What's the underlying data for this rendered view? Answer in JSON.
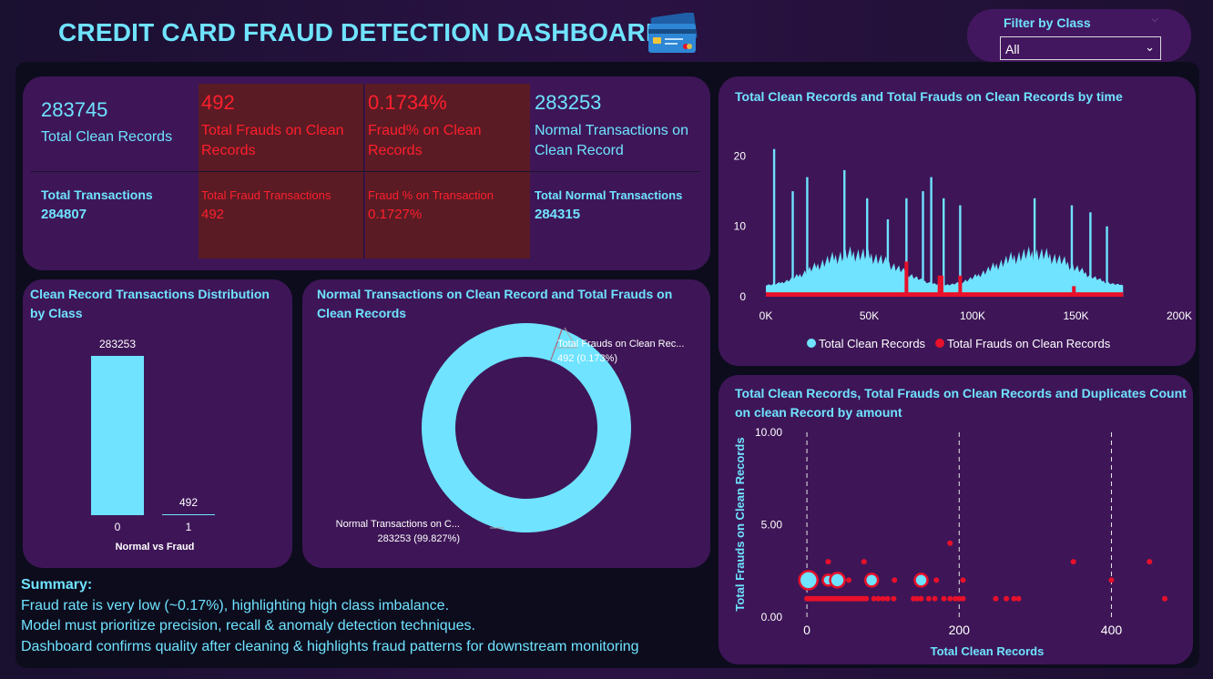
{
  "header": {
    "title": "CREDIT CARD FRAUD DETECTION DASHBOARD",
    "card_icon": "credit-card-icon"
  },
  "filter": {
    "label": "Filter by Class",
    "value": "All"
  },
  "kpis": {
    "row1": [
      {
        "value": "283745",
        "label": "Total Clean Records"
      },
      {
        "value": "492",
        "label": "Total Frauds on Clean Records"
      },
      {
        "value": "0.1734%",
        "label": "Fraud% on Clean Records"
      },
      {
        "value": "283253",
        "label": "Normal Transactions on Clean Record"
      }
    ],
    "row2": [
      {
        "label": "Total Transactions",
        "value": "284807"
      },
      {
        "label": "Total Fraud Transactions",
        "value": "492"
      },
      {
        "label": "Fraud % on Transaction",
        "value": "0.1727%"
      },
      {
        "label": "Total Normal Transactions",
        "value": "284315"
      }
    ]
  },
  "colors": {
    "cyan": "#6fe3ff",
    "red": "#e8102a",
    "panel": "#3e1657",
    "kpi_red_bg": "#5a1b24"
  },
  "summary": {
    "heading": "Summary:",
    "lines": [
      "Fraud rate is very low (~0.17%), highlighting high class imbalance.",
      "Model must prioritize precision, recall & anomaly detection techniques.",
      "Dashboard confirms quality after cleaning & highlights fraud patterns for downstream monitoring"
    ]
  },
  "chart_data": [
    {
      "id": "bar",
      "type": "bar",
      "title": "Clean Record Transactions Distribution by Class",
      "categories": [
        "0",
        "1"
      ],
      "values": [
        283253,
        492
      ],
      "value_labels": [
        "283253",
        "492"
      ],
      "xlabel": "Normal vs Fraud",
      "ylabel": "",
      "ylim": [
        0,
        283253
      ]
    },
    {
      "id": "donut",
      "type": "pie",
      "title": "Normal Transactions on Clean Record and Total Frauds on Clean Records",
      "slices": [
        {
          "name": "Normal Transactions on C...",
          "value": 283253,
          "label": "283253 (99.827%)"
        },
        {
          "name": "Total Frauds on Clean Rec...",
          "value": 492,
          "label": "492 (0.173%)"
        }
      ]
    },
    {
      "id": "time",
      "type": "area",
      "title": "Total Clean Records and Total Frauds on Clean Records by time",
      "xlabel": "",
      "ylabel": "",
      "xlim": [
        0,
        200000
      ],
      "ylim": [
        0,
        22
      ],
      "xticks": [
        {
          "v": 0,
          "label": "0K"
        },
        {
          "v": 50000,
          "label": "50K"
        },
        {
          "v": 100000,
          "label": "100K"
        },
        {
          "v": 150000,
          "label": "150K"
        },
        {
          "v": 200000,
          "label": "200K"
        }
      ],
      "yticks": [
        {
          "v": 0,
          "label": "0"
        },
        {
          "v": 10,
          "label": "10"
        },
        {
          "v": 20,
          "label": "20"
        }
      ],
      "legend": [
        "Total Clean Records",
        "Total Frauds on Clean Records"
      ],
      "legend_position": "bottom",
      "series": [
        {
          "name": "Total Clean Records",
          "x_range": [
            0,
            172800
          ],
          "typical_high": 5,
          "spikes": [
            [
              4000,
              21
            ],
            [
              13000,
              15
            ],
            [
              20000,
              17
            ],
            [
              38000,
              18
            ],
            [
              49000,
              14
            ],
            [
              59000,
              11
            ],
            [
              68000,
              14
            ],
            [
              76000,
              15
            ],
            [
              80000,
              17
            ],
            [
              86000,
              14
            ],
            [
              94000,
              13
            ],
            [
              130000,
              14
            ],
            [
              148000,
              13
            ],
            [
              157000,
              12
            ],
            [
              165000,
              10
            ]
          ]
        },
        {
          "name": "Total Frauds on Clean Records",
          "x_range": [
            0,
            172800
          ],
          "typical": 0.5,
          "spikes": [
            [
              68000,
              5
            ],
            [
              84000,
              3
            ],
            [
              85000,
              3
            ],
            [
              94000,
              3
            ],
            [
              149000,
              1.5
            ]
          ]
        }
      ]
    },
    {
      "id": "scatter",
      "type": "scatter",
      "title": "Total Clean Records, Total Frauds on Clean Records and Duplicates Count on clean Record by amount",
      "xlabel": "Total Clean Records",
      "ylabel": "Total Frauds on Clean Records",
      "xlim": [
        -30,
        470
      ],
      "ylim": [
        0,
        10
      ],
      "xticks": [
        {
          "v": 0,
          "label": "0"
        },
        {
          "v": 200,
          "label": "200"
        },
        {
          "v": 400,
          "label": "400"
        }
      ],
      "yticks": [
        {
          "v": 0,
          "label": "0.00"
        },
        {
          "v": 5,
          "label": "5.00"
        },
        {
          "v": 10,
          "label": "10.00"
        }
      ],
      "reference_lines_x": [
        0,
        200,
        400
      ],
      "points_fraud_1": [
        0,
        3,
        6,
        9,
        12,
        15,
        18,
        21,
        24,
        27,
        30,
        33,
        36,
        39,
        42,
        45,
        48,
        51,
        54,
        57,
        60,
        63,
        66,
        69,
        72,
        75,
        78,
        88,
        94,
        100,
        106,
        114,
        140,
        145,
        150,
        160,
        168,
        180,
        188,
        195,
        200,
        205,
        248,
        262,
        272,
        278,
        470
      ],
      "points_fraud_2": [
        0,
        28,
        40,
        55,
        85,
        115,
        150,
        170,
        205,
        400
      ],
      "points_fraud_3": [
        28,
        75,
        350,
        450
      ],
      "points_fraud_4": [
        188
      ],
      "bubbles": [
        {
          "x": 2,
          "y": 2,
          "size": 10
        },
        {
          "x": 28,
          "y": 2,
          "size": 6
        },
        {
          "x": 40,
          "y": 2,
          "size": 8
        },
        {
          "x": 85,
          "y": 2,
          "size": 7
        },
        {
          "x": 150,
          "y": 2,
          "size": 7
        }
      ]
    }
  ]
}
